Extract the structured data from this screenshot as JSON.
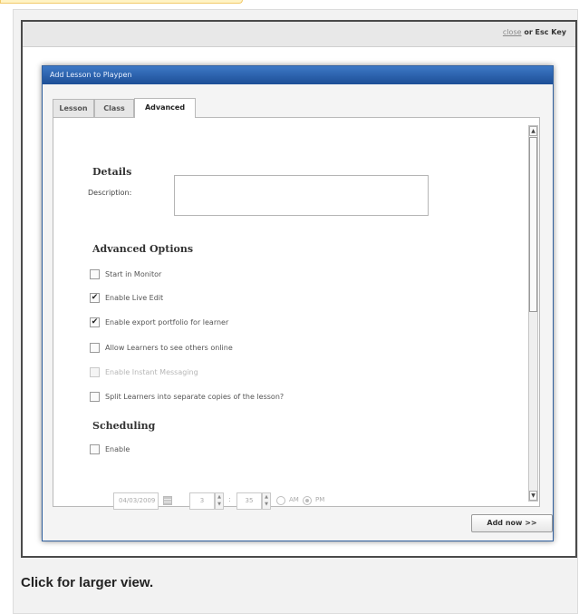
{
  "top_banner": {},
  "screenshot": {
    "close_link": "close",
    "close_rest": " or Esc Key"
  },
  "dialog": {
    "title": "Add Lesson to Playpen",
    "tabs": [
      {
        "label": "Lesson"
      },
      {
        "label": "Class"
      },
      {
        "label": "Advanced"
      }
    ],
    "details_heading": "Details",
    "description_label": "Description:",
    "description_value": "",
    "advanced_heading": "Advanced Options",
    "options": [
      {
        "label": "Start in Monitor",
        "checked": false,
        "enabled": true
      },
      {
        "label": "Enable Live Edit",
        "checked": true,
        "enabled": true
      },
      {
        "label": "Enable export portfolio for learner",
        "checked": true,
        "enabled": true
      },
      {
        "label": "Allow Learners to see others online",
        "checked": false,
        "enabled": true
      },
      {
        "label": "Enable Instant Messaging",
        "checked": false,
        "enabled": false
      },
      {
        "label": "Split Learners into separate copies of the lesson?",
        "checked": false,
        "enabled": true
      }
    ],
    "scheduling_heading": "Scheduling",
    "schedule_enable_label": "Enable",
    "schedule_date": "04/03/2009",
    "schedule_hour": "3",
    "schedule_minute": "35",
    "am_label": "AM",
    "pm_label": "PM",
    "add_button": "Add now >>"
  },
  "caption": "Click for larger view."
}
